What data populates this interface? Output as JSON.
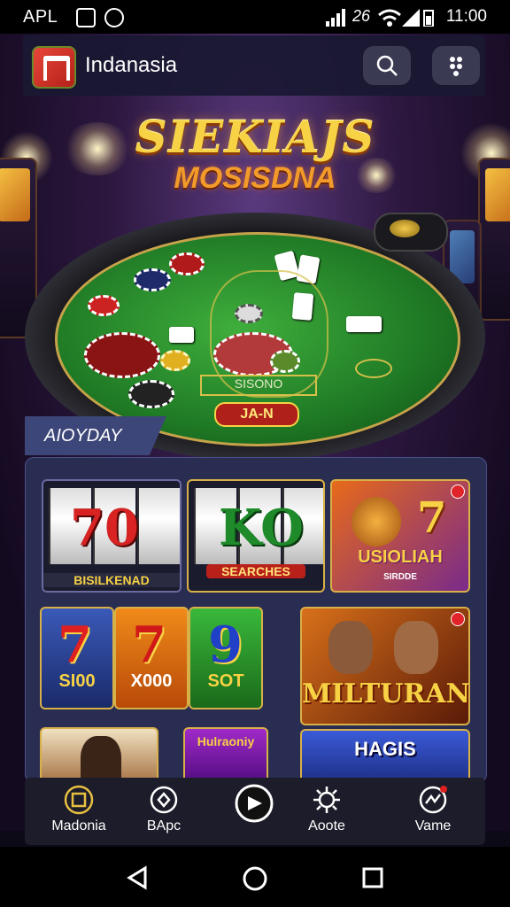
{
  "status_bar": {
    "carrier": "APL",
    "signal_text": "26",
    "time": "11:00"
  },
  "app_header": {
    "title": "Indanasia",
    "search_icon": "search-icon",
    "menu_icon": "more-vertical-icon"
  },
  "hero": {
    "title_line1": "SIEKIAJS",
    "title_line2": "MOSISDNA"
  },
  "table": {
    "label": "SISONO",
    "badge": "JA-N"
  },
  "section": {
    "label": "AIOYDAY"
  },
  "games": [
    {
      "label": "BISILKENAD",
      "symbol": "70"
    },
    {
      "label": "SEARCHES",
      "symbol": "KO"
    },
    {
      "label": "USIOLIAH",
      "sub": "SIRDDE",
      "symbol": "7"
    },
    {
      "label": "SI00",
      "symbol": "7"
    },
    {
      "label": "X000",
      "symbol": "7"
    },
    {
      "label": "SOT",
      "symbol": "9"
    },
    {
      "label": "MILTURAN"
    },
    {
      "label": "HAGIS"
    },
    {
      "label": "Hulraoniy"
    }
  ],
  "bottom_nav": [
    {
      "label": "Madonia",
      "icon": "home-icon"
    },
    {
      "label": "BApc",
      "icon": "settings-icon"
    },
    {
      "label": "",
      "icon": "play-icon"
    },
    {
      "label": "Aoote",
      "icon": "gear-icon"
    },
    {
      "label": "Vame",
      "icon": "wallet-icon"
    }
  ],
  "colors": {
    "accent": "#f7d244",
    "panel": "#2a2d52",
    "felt": "#1f7a25"
  }
}
